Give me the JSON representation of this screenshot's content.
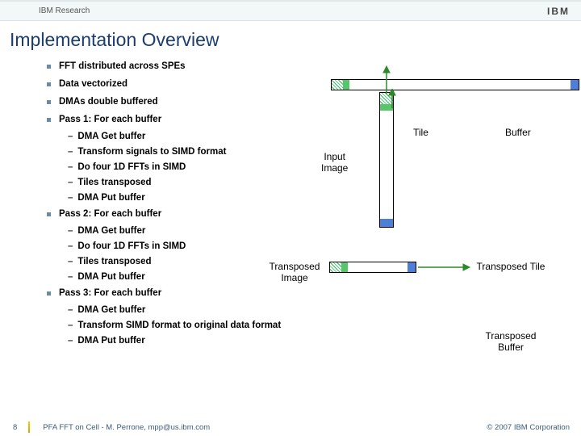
{
  "header": {
    "research": "IBM Research",
    "logo": "IBM"
  },
  "title": "Implementation Overview",
  "bullets": [
    {
      "text": "FFT distributed across SPEs",
      "sub": []
    },
    {
      "text": "Data vectorized",
      "sub": []
    },
    {
      "text": "DMAs double buffered",
      "sub": []
    },
    {
      "text": "Pass 1: For each buffer",
      "sub": [
        "DMA Get buffer",
        "Transform signals to SIMD format",
        "Do  four 1D FFTs in SIMD",
        "Tiles transposed",
        "DMA Put buffer"
      ]
    },
    {
      "text": "Pass 2: For each buffer",
      "sub": [
        "DMA Get buffer",
        "Do  four 1D FFTs in SIMD",
        "Tiles transposed",
        "DMA Put buffer"
      ]
    },
    {
      "text": "Pass 3: For each buffer",
      "sub": [
        "DMA Get buffer",
        "Transform SIMD format to original data format",
        "DMA Put buffer"
      ]
    }
  ],
  "diagram": {
    "tile": "Tile",
    "buffer": "Buffer",
    "input_image": "Input\nImage",
    "transposed_image": "Transposed\nImage",
    "transposed_tile": "Transposed\nTile",
    "transposed_buffer": "Transposed\nBuffer"
  },
  "footer": {
    "page": "8",
    "text": "PFA FFT on Cell - M. Perrone,  mpp@us.ibm.com",
    "copyright": "© 2007 IBM Corporation"
  }
}
